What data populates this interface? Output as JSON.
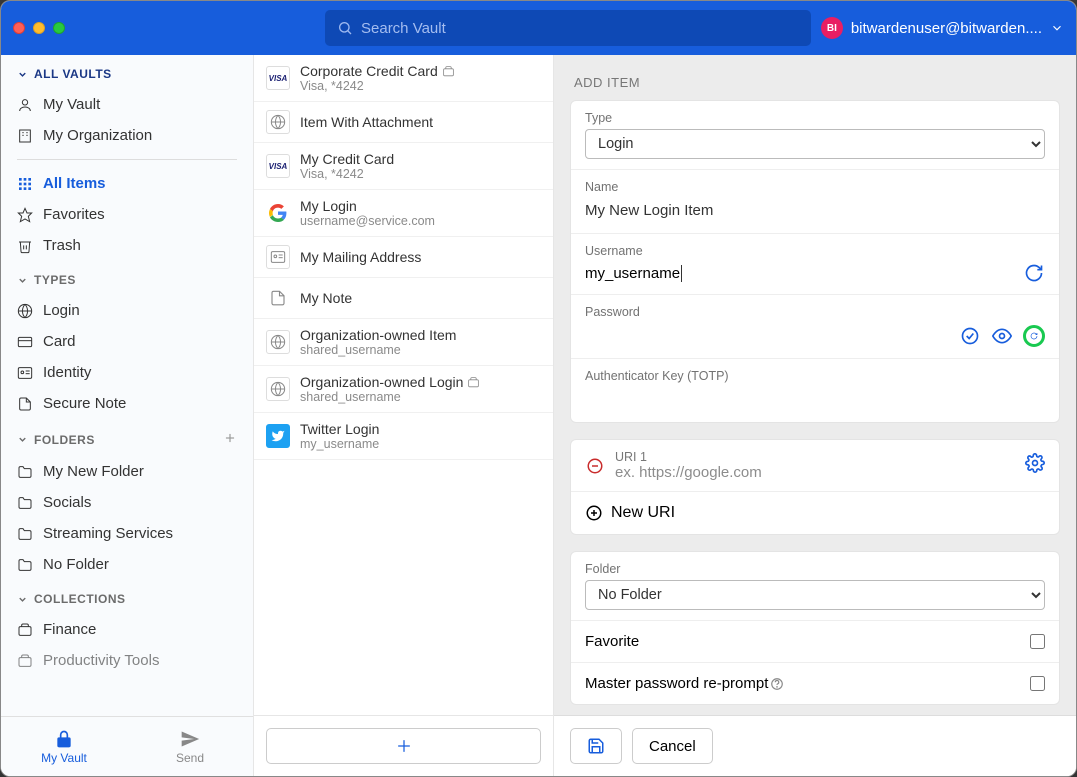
{
  "header": {
    "search_placeholder": "Search Vault",
    "user_initials": "BI",
    "user_email": "bitwardenuser@bitwarden...."
  },
  "sidebar": {
    "all_vaults": "ALL VAULTS",
    "my_vault": "My Vault",
    "my_org": "My Organization",
    "all_items": "All Items",
    "favorites": "Favorites",
    "trash": "Trash",
    "types_hdr": "TYPES",
    "login": "Login",
    "card": "Card",
    "identity": "Identity",
    "secure_note": "Secure Note",
    "folders_hdr": "FOLDERS",
    "folders": [
      "My New Folder",
      "Socials",
      "Streaming Services",
      "No Folder"
    ],
    "collections_hdr": "COLLECTIONS",
    "collections": [
      "Finance",
      "Productivity Tools"
    ],
    "tab_vault": "My Vault",
    "tab_send": "Send"
  },
  "items": [
    {
      "title": "Corporate Credit Card",
      "sub": "Visa, *4242",
      "icon": "visa",
      "attach": true
    },
    {
      "title": "Item With Attachment",
      "sub": "",
      "icon": "globe"
    },
    {
      "title": "My Credit Card",
      "sub": "Visa, *4242",
      "icon": "visa"
    },
    {
      "title": "My Login",
      "sub": "username@service.com",
      "icon": "google"
    },
    {
      "title": "My Mailing Address",
      "sub": "",
      "icon": "identity"
    },
    {
      "title": "My Note",
      "sub": "",
      "icon": "note"
    },
    {
      "title": "Organization-owned Item",
      "sub": "shared_username",
      "icon": "globe"
    },
    {
      "title": "Organization-owned Login",
      "sub": "shared_username",
      "icon": "globe",
      "attach": true
    },
    {
      "title": "Twitter Login",
      "sub": "my_username",
      "icon": "twitter"
    }
  ],
  "editor": {
    "heading": "ADD ITEM",
    "type_lbl": "Type",
    "type_val": "Login",
    "name_lbl": "Name",
    "name_val": "My New Login Item",
    "user_lbl": "Username",
    "user_val": "my_username",
    "pass_lbl": "Password",
    "totp_lbl": "Authenticator Key (TOTP)",
    "uri1_lbl": "URI 1",
    "uri1_ph": "ex. https://google.com",
    "new_uri": "New URI",
    "folder_lbl": "Folder",
    "folder_val": "No Folder",
    "favorite_lbl": "Favorite",
    "reprompt_lbl": "Master password re-prompt",
    "cancel": "Cancel"
  }
}
